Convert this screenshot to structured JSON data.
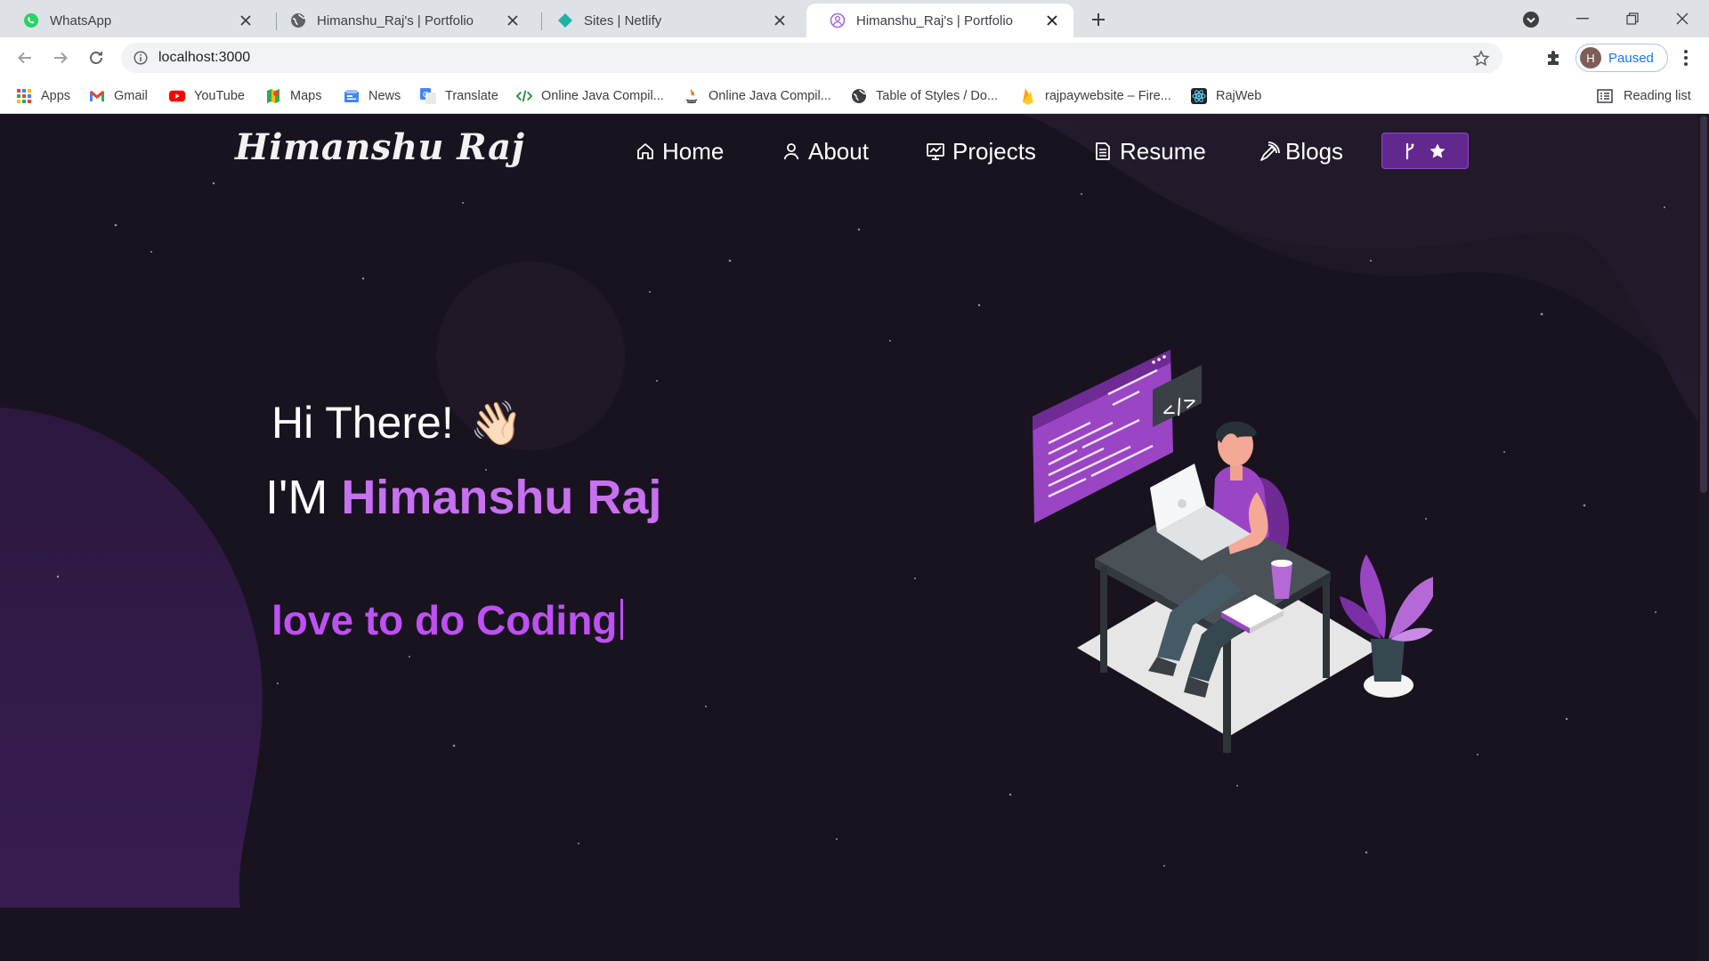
{
  "browser": {
    "tabs": [
      {
        "title": "WhatsApp",
        "icon": "whatsapp-icon"
      },
      {
        "title": "Himanshu_Raj's | Portfolio",
        "icon": "globe-icon"
      },
      {
        "title": "Sites | Netlify",
        "icon": "netlify-icon"
      },
      {
        "title": "Himanshu_Raj's | Portfolio",
        "icon": "portfolio-icon",
        "active": true
      }
    ],
    "url": "localhost:3000",
    "profile_initial": "H",
    "profile_status": "Paused",
    "bookmarks": [
      {
        "label": "Apps",
        "icon": "apps-grid-icon"
      },
      {
        "label": "Gmail",
        "icon": "gmail-icon"
      },
      {
        "label": "YouTube",
        "icon": "youtube-icon"
      },
      {
        "label": "Maps",
        "icon": "maps-icon"
      },
      {
        "label": "News",
        "icon": "news-icon"
      },
      {
        "label": "Translate",
        "icon": "translate-icon"
      },
      {
        "label": "Online Java Compil...",
        "icon": "code-icon"
      },
      {
        "label": "Online Java Compil...",
        "icon": "java-icon"
      },
      {
        "label": "Table of Styles / Do...",
        "icon": "globe-icon"
      },
      {
        "label": "rajpaywebsite – Fire...",
        "icon": "firebase-icon"
      },
      {
        "label": "RajWeb",
        "icon": "react-icon"
      }
    ],
    "reading_list": "Reading list"
  },
  "site": {
    "brand": "Himanshu Raj",
    "nav": [
      {
        "label": "Home",
        "icon": "home-icon"
      },
      {
        "label": "About",
        "icon": "user-icon"
      },
      {
        "label": "Projects",
        "icon": "projects-icon"
      },
      {
        "label": "Resume",
        "icon": "document-icon"
      },
      {
        "label": "Blogs",
        "icon": "blog-icon"
      }
    ],
    "greeting": "Hi There!",
    "wave": "👋🏻",
    "intro_prefix": "I'M",
    "intro_name": "Himanshu Raj",
    "typed_text": "love to do Coding"
  },
  "colors": {
    "accent": "#c770f0",
    "typed": "#be50f4",
    "button_bg": "#62288f",
    "page_bg": "#19131f"
  }
}
